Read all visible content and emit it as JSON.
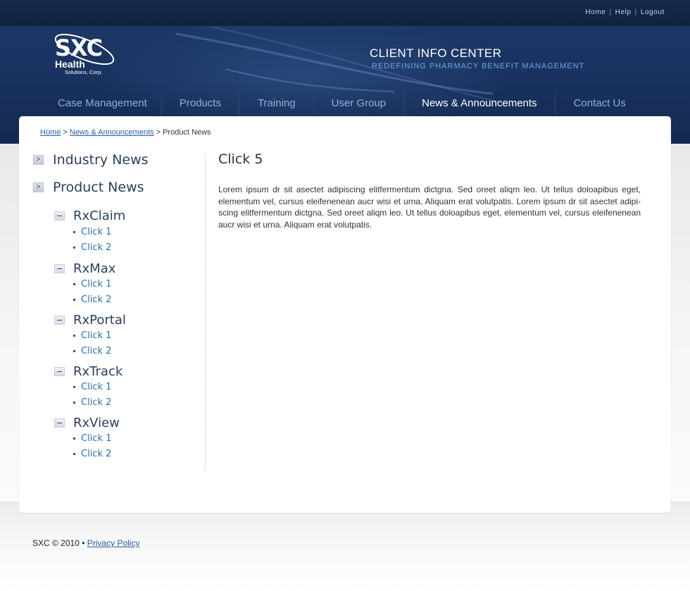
{
  "utility_nav": [
    "Home",
    "Help",
    "Logout"
  ],
  "logo": {
    "line1": "SXC",
    "line2": "Health",
    "line3": "Solutions, Corp."
  },
  "tagline": {
    "title": "CLIENT INFO CENTER",
    "subtitle": "REDEFINING PHARMACY BENEFIT MANAGEMENT"
  },
  "main_nav": [
    {
      "label": "Case Management",
      "active": false
    },
    {
      "label": "Products",
      "active": false
    },
    {
      "label": "Training",
      "active": false
    },
    {
      "label": "User Group",
      "active": false
    },
    {
      "label": "News & Announcements",
      "active": true
    },
    {
      "label": "Contact Us",
      "active": false
    }
  ],
  "breadcrumb": {
    "home": "Home",
    "section": "News & Announcements",
    "current": "Product News"
  },
  "sidebar": {
    "sections": [
      {
        "label": "Industry News",
        "icon": "arrow-right-icon"
      },
      {
        "label": "Product News",
        "icon": "arrow-right-icon"
      }
    ],
    "products": [
      {
        "name": "RxClaim",
        "items": [
          "Click 1",
          "Click 2"
        ]
      },
      {
        "name": "RxMax",
        "items": [
          "Click 1",
          "Click 2"
        ]
      },
      {
        "name": "RxPortal",
        "items": [
          "Click 1",
          "Click 2"
        ]
      },
      {
        "name": "RxTrack",
        "items": [
          "Click 1",
          "Click 2"
        ]
      },
      {
        "name": "RxView",
        "items": [
          "Click 1",
          "Click 2"
        ]
      }
    ]
  },
  "article": {
    "title": "Click 5",
    "body": "Lorem ipsum dr sit asectet adipiscing elitfermentum dictgna. Sed oreet aliqm leo. Ut tellus doloapibus eget, elementum vel, cursus eleifenenean aucr wisi et urna. Aliquam erat volutpatis. Lorem ipsum dr sit asectet adipi-scing elitfermentum dictgna. Sed oreet aliqm leo. Ut tellus doloapibus eget, elementum vel, cursus eleifenenean aucr wisi et urna. Aliquam erat volutpatis."
  },
  "footer": {
    "copyright": "SXC © 2010 •",
    "privacy": "Privacy Policy"
  },
  "colors": {
    "header": "#193260",
    "nav_inactive": "#8fb0d8",
    "link": "#2f6ea8",
    "tagline_sub": "#6ea6e0"
  }
}
